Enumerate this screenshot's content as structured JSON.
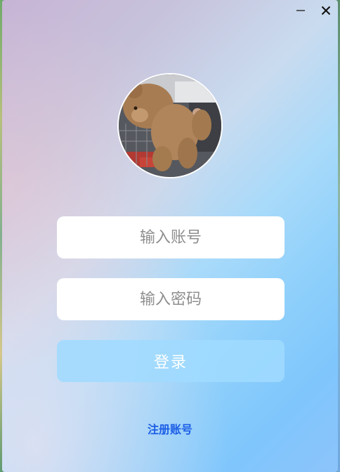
{
  "window": {
    "minimize_icon": "minimize-icon",
    "close_icon": "close-icon"
  },
  "avatar": {
    "description_icon": "teddy-bear-photo"
  },
  "login_form": {
    "account_placeholder": "输入账号",
    "password_placeholder": "输入密码",
    "login_label": "登录",
    "register_label": "注册账号"
  },
  "colors": {
    "login_button": "#a0daff",
    "register_link": "#1c5ee6",
    "field_background": "#ffffff"
  }
}
